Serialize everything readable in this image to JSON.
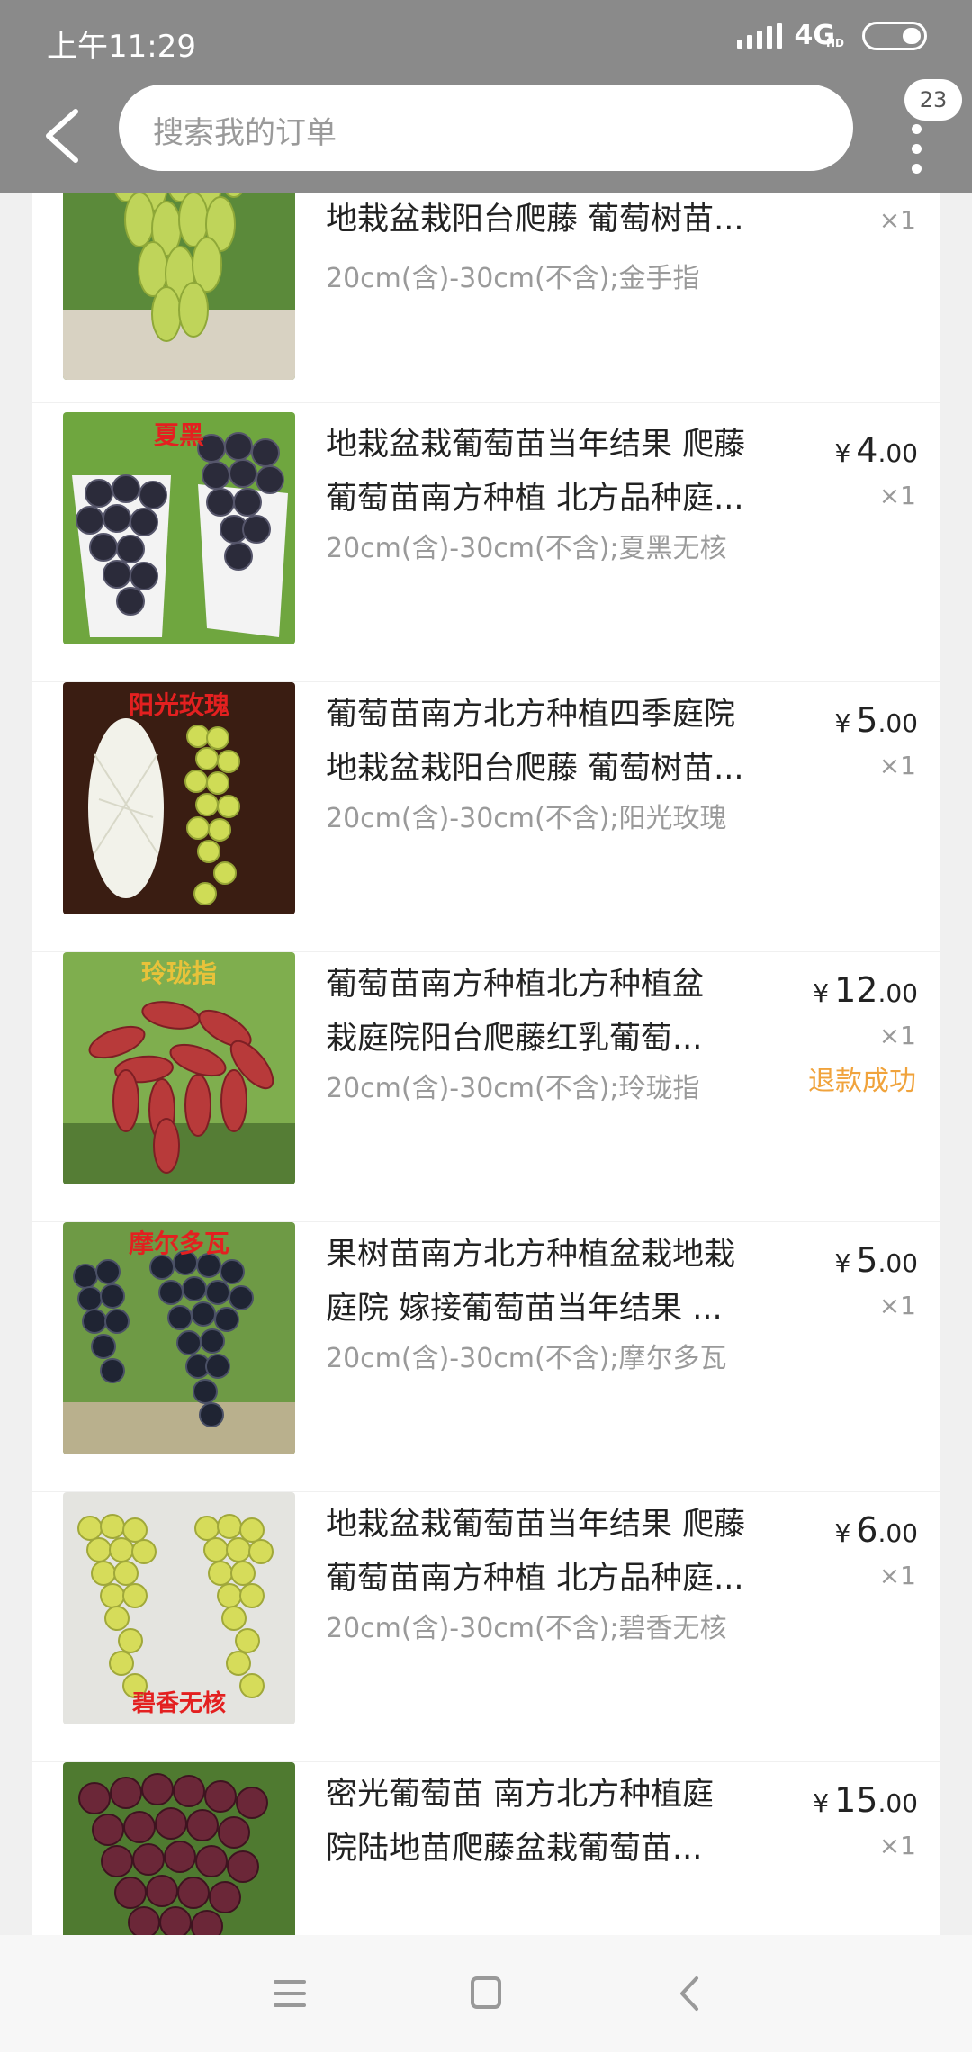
{
  "status_bar": {
    "time": "上午11:29",
    "network": "4G",
    "network_sub": "HD"
  },
  "header": {
    "search_placeholder": "搜索我的订单",
    "badge_count": "23"
  },
  "orders": [
    {
      "title_line1": "地栽盆栽阳台爬藤 葡萄树苗...",
      "title_line2": "",
      "spec": "20cm(含)-30cm(不含);金手指",
      "price_int": "",
      "price_dec": "",
      "currency": "",
      "qty": "×1",
      "status": "",
      "image_caption": "",
      "image_theme": "green-long-grape"
    },
    {
      "title_line1": "地栽盆栽葡萄苗当年结果 爬藤",
      "title_line2": "葡萄苗南方种植 北方品种庭...",
      "spec": "20cm(含)-30cm(不含);夏黑无核",
      "currency": "¥",
      "price_int": "4",
      "price_dec": ".00",
      "qty": "×1",
      "status": "",
      "image_caption": "夏黑",
      "image_theme": "black-grape"
    },
    {
      "title_line1": "葡萄苗南方北方种植四季庭院",
      "title_line2": "地栽盆栽阳台爬藤 葡萄树苗...",
      "spec": "20cm(含)-30cm(不含);阳光玫瑰",
      "currency": "¥",
      "price_int": "5",
      "price_dec": ".00",
      "qty": "×1",
      "status": "",
      "image_caption": "阳光玫瑰",
      "image_theme": "green-grape-dark"
    },
    {
      "title_line1": "葡萄苗南方种植北方种植盆",
      "title_line2": "栽庭院阳台爬藤红乳葡萄...",
      "spec": "20cm(含)-30cm(不含);玲珑指",
      "currency": "¥",
      "price_int": "12",
      "price_dec": ".00",
      "qty": "×1",
      "status": "退款成功",
      "image_caption": "玲珑指",
      "image_theme": "red-finger-grape"
    },
    {
      "title_line1": "果树苗南方北方种植盆栽地栽",
      "title_line2": "庭院 嫁接葡萄苗当年结果 ...",
      "spec": "20cm(含)-30cm(不含);摩尔多瓦",
      "currency": "¥",
      "price_int": "5",
      "price_dec": ".00",
      "qty": "×1",
      "status": "",
      "image_caption": "摩尔多瓦",
      "image_theme": "dark-blue-grape"
    },
    {
      "title_line1": "地栽盆栽葡萄苗当年结果 爬藤",
      "title_line2": "葡萄苗南方种植 北方品种庭...",
      "spec": "20cm(含)-30cm(不含);碧香无核",
      "currency": "¥",
      "price_int": "6",
      "price_dec": ".00",
      "qty": "×1",
      "status": "",
      "image_caption": "碧香无核",
      "image_theme": "yellow-green-grape"
    },
    {
      "title_line1": "密光葡萄苗 南方北方种植庭",
      "title_line2": "院陆地苗爬藤盆栽葡萄苗...",
      "spec": "",
      "currency": "¥",
      "price_int": "15",
      "price_dec": ".00",
      "qty": "×1",
      "status": "",
      "image_caption": "",
      "image_theme": "purple-red-grape"
    }
  ],
  "icons": {
    "back": "chevron-left-icon",
    "more": "more-vertical-icon",
    "nav_menu": "menu-icon",
    "nav_home": "square-icon",
    "nav_back": "triangle-back-icon"
  },
  "colors": {
    "header_bg": "#8a8a8a",
    "refund_status": "#f0a33c",
    "text": "#222222",
    "muted": "#9a9a9a"
  }
}
